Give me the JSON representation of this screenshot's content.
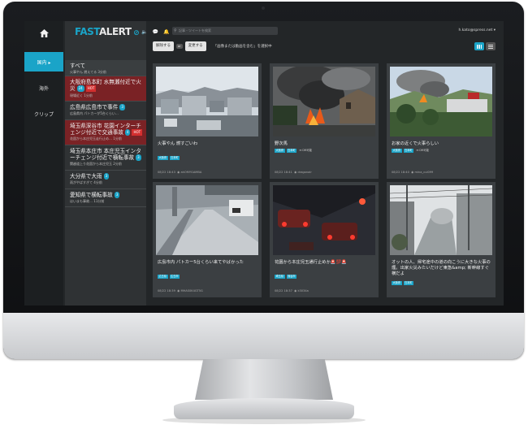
{
  "app": {
    "brand_fast": "FAST",
    "brand_alert": "ALERT"
  },
  "nav": {
    "home_icon": "home-icon",
    "items": [
      {
        "label": "国内 ▸"
      },
      {
        "label": "海外"
      },
      {
        "label": "クリップ"
      }
    ]
  },
  "header": {
    "search_placeholder": "記事・ツイートを検索",
    "user": "h.kato@spress.net ▾",
    "filter": {
      "btn1": "解除する",
      "mid": "or",
      "btn2": "変更する",
      "desc": "「画像または動画を含む」を選択中"
    }
  },
  "events": [
    {
      "title": "すべて",
      "sub": "火事やん 燃えてる 3分前",
      "badge": "",
      "hot": false,
      "all": true
    },
    {
      "title": "大阪府島本町 水無瀬付近で火災",
      "sub": "現場近く 1分前",
      "badge": "24",
      "hot": true
    },
    {
      "title": "広島県広島市で事件",
      "sub": "広島県内 パトカーが5台くらい…",
      "badge": "3",
      "hot": false
    },
    {
      "title": "埼玉県深谷市 花園インターチェンジ付近で交通事故",
      "sub": "花園から本庄児玉走行止め… 1分前",
      "badge": "4",
      "hot": true
    },
    {
      "title": "埼玉県本庄市 本庄児玉インターチェンジ付近で横転事故",
      "sub": "関越道上り花園から本庄児玉 2分前",
      "badge": "3",
      "hot": false
    },
    {
      "title": "大分県で大雨",
      "sub": "雨がやばすぎて 4分前",
      "badge": "3",
      "hot": false
    },
    {
      "title": "愛知県で横転事故",
      "sub": "はいまも事故… 11分前",
      "badge": "3",
      "hot": false
    }
  ],
  "cards": [
    {
      "title": "火事やん 燃すごいわ",
      "tags": [
        "大阪府",
        "島本町"
      ],
      "date": "08/22 18:43",
      "user": "ahOMYGAMBA"
    },
    {
      "title": "野次馬",
      "tags": [
        "大阪府",
        "島本町"
      ],
      "extra": "DM可能",
      "date": "08/22 18:41",
      "user": "dragonair"
    },
    {
      "title": "お家の近くで火事らしい",
      "tags": [
        "大阪府",
        "島本町"
      ],
      "extra": "DM可能",
      "date": "08/22 18:40",
      "user": "mina_cul099"
    },
    {
      "title": "広島市内 パトカー5台くらい来てやばかった",
      "tags": [
        "広島県",
        "広島市"
      ],
      "date": "08/22 18:39",
      "user": "MHAS0K4GT5G"
    },
    {
      "title": "花園から本庄児玉通行止めか🚨💯🚨",
      "tags": [
        "埼玉県",
        "深谷市"
      ],
      "date": "08/22 18:37",
      "user": "k3034a"
    },
    {
      "title": "オットの人、帰宅途中の道の向こうに大きな火事の煙。出家火災みたいだけど東急&amp; 新幹線すぐ横だよ",
      "tags": [
        "大阪府",
        "島本町"
      ],
      "date": "08/22 18:36",
      "user": ""
    }
  ],
  "colors": {
    "accent": "#1aa4c8",
    "hot": "#7a2225"
  }
}
